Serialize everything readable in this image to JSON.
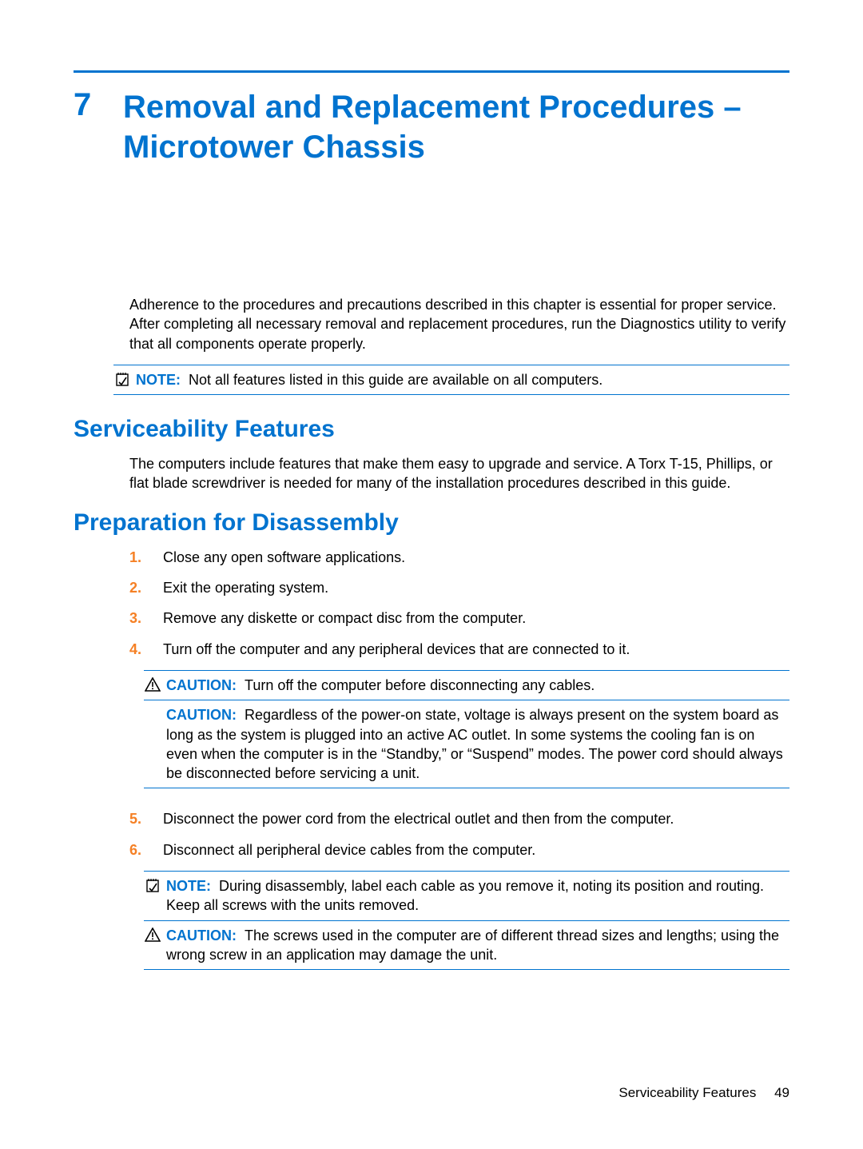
{
  "chapter": {
    "number": "7",
    "title": "Removal and Replacement Procedures – Microtower Chassis"
  },
  "intro_paragraph": "Adherence to the procedures and precautions described in this chapter is essential for proper service. After completing all necessary removal and replacement procedures, run the Diagnostics utility to verify that all components operate properly.",
  "note_top": {
    "label": "NOTE:",
    "text": "Not all features listed in this guide are available on all computers."
  },
  "section1": {
    "heading": "Serviceability Features",
    "paragraph": "The computers include features that make them easy to upgrade and service. A Torx T-15, Phillips, or flat blade screwdriver is needed for many of the installation procedures described in this guide."
  },
  "section2": {
    "heading": "Preparation for Disassembly",
    "steps": [
      "Close any open software applications.",
      "Exit the operating system.",
      "Remove any diskette or compact disc from the computer.",
      "Turn off the computer and any peripheral devices that are connected to it."
    ],
    "caution1": {
      "label": "CAUTION:",
      "text": "Turn off the computer before disconnecting any cables."
    },
    "caution2": {
      "label": "CAUTION:",
      "text": "Regardless of the power-on state, voltage is always present on the system board as long as the system is plugged into an active AC outlet. In some systems the cooling fan is on even when the computer is in the “Standby,” or “Suspend” modes. The power cord should always be disconnected before servicing a unit."
    },
    "steps2": [
      "Disconnect the power cord from the electrical outlet and then from the computer.",
      "Disconnect all peripheral device cables from the computer."
    ],
    "note_bottom": {
      "label": "NOTE:",
      "text": "During disassembly, label each cable as you remove it, noting its position and routing. Keep all screws with the units removed."
    },
    "caution3": {
      "label": "CAUTION:",
      "text": "The screws used in the computer are of different thread sizes and lengths; using the wrong screw in an application may damage the unit."
    },
    "step_numbers": [
      "1.",
      "2.",
      "3.",
      "4.",
      "5.",
      "6."
    ]
  },
  "footer": {
    "section": "Serviceability Features",
    "page": "49"
  }
}
